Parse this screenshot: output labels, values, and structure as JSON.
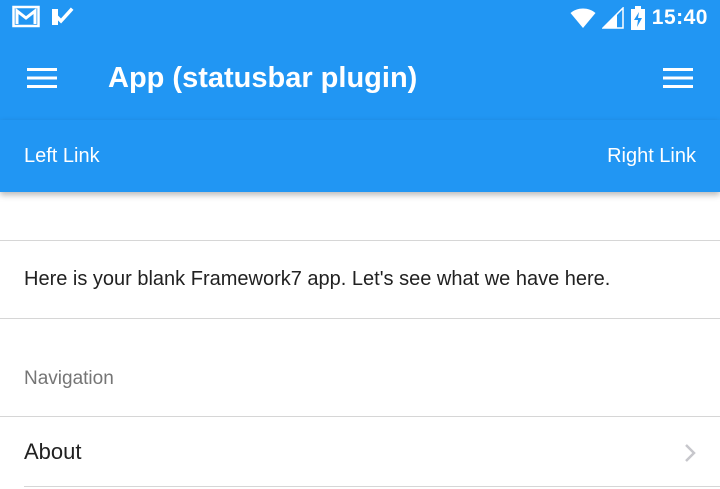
{
  "statusbar": {
    "time": "15:40",
    "icons_left": [
      "gmail-icon",
      "tasks-check-icon"
    ],
    "icons_right": [
      "wifi-icon",
      "cell-signal-icon",
      "battery-charging-icon"
    ]
  },
  "navbar": {
    "title": "App (statusbar plugin)",
    "left_icon": "menu-icon",
    "right_icon": "menu-icon"
  },
  "toolbar": {
    "left_link": "Left Link",
    "right_link": "Right Link"
  },
  "content": {
    "intro_text": "Here is your blank Framework7 app. Let's see what we have here.",
    "section_title": "Navigation",
    "list": [
      {
        "label": "About",
        "icon": "chevron-right-icon"
      }
    ]
  },
  "colors": {
    "primary": "#2196f3",
    "text": "#212121",
    "muted": "#757575",
    "divider": "#d6d6d6"
  }
}
